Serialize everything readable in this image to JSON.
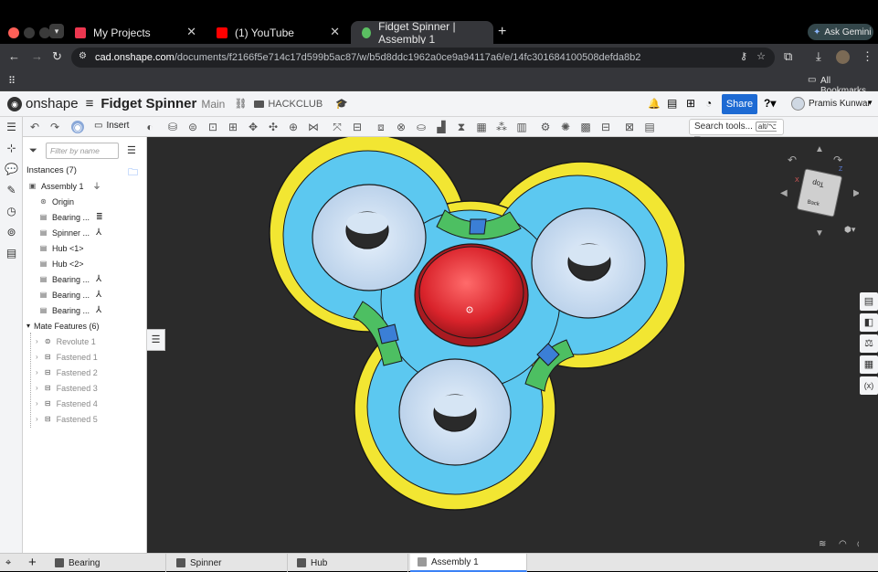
{
  "browser": {
    "tabs": [
      {
        "label": "My Projects",
        "active": false
      },
      {
        "label": "(1) YouTube",
        "active": false
      },
      {
        "label": "Fidget Spinner | Assembly 1",
        "active": true
      }
    ],
    "new_tab": "+",
    "ask_gemini": "Ask Gemini",
    "url_domain": "cad.onshape.com",
    "url_path": "/documents/f2166f5e714c17d599b5ac87/w/b5d8ddc1962a0ce9a94117a6/e/14fc301684100508defda8b2",
    "all_bookmarks": "All Bookmarks"
  },
  "app": {
    "brand": "onshape",
    "doc_title": "Fidget Spinner",
    "branch": "Main",
    "folder": "HACKCLUB",
    "share": "Share",
    "user": "Pramis Kunwar"
  },
  "toolbar": {
    "insert": "Insert",
    "search_tools": "Search tools...",
    "search_shortcut": "alt/⌥ c"
  },
  "panel": {
    "filter_placeholder": "Filter by name",
    "instances_header": "Instances (7)",
    "items": [
      {
        "label": "Assembly 1",
        "icon": "assembly-icon"
      },
      {
        "label": "Origin",
        "icon": "origin-icon"
      },
      {
        "label": "Bearing ...",
        "icon": "part-icon"
      },
      {
        "label": "Spinner ...",
        "icon": "part-icon"
      },
      {
        "label": "Hub <1>",
        "icon": "part-icon"
      },
      {
        "label": "Hub <2>",
        "icon": "part-icon"
      },
      {
        "label": "Bearing ...",
        "icon": "part-icon"
      },
      {
        "label": "Bearing ...",
        "icon": "part-icon"
      },
      {
        "label": "Bearing ...",
        "icon": "part-icon"
      }
    ],
    "mate_header": "Mate Features (6)",
    "mates": [
      "Revolute 1",
      "Fastened 1",
      "Fastened 2",
      "Fastened 3",
      "Fastened 4",
      "Fastened 5"
    ]
  },
  "viewcube": {
    "top": "Top",
    "back": "Back",
    "x": "X",
    "z": "Z"
  },
  "bottom_tabs": [
    {
      "label": "Bearing",
      "active": false
    },
    {
      "label": "Spinner",
      "active": false
    },
    {
      "label": "Hub",
      "active": false
    },
    {
      "label": "Assembly 1",
      "active": true
    }
  ],
  "colors": {
    "yellow": "#f2e632",
    "blue": "#5cc8f0",
    "green": "#4dbf62",
    "bearing": "#c4daf0",
    "red": "#d9232b",
    "viewport": "#2b2b2b",
    "accent": "#1d6ad3"
  }
}
